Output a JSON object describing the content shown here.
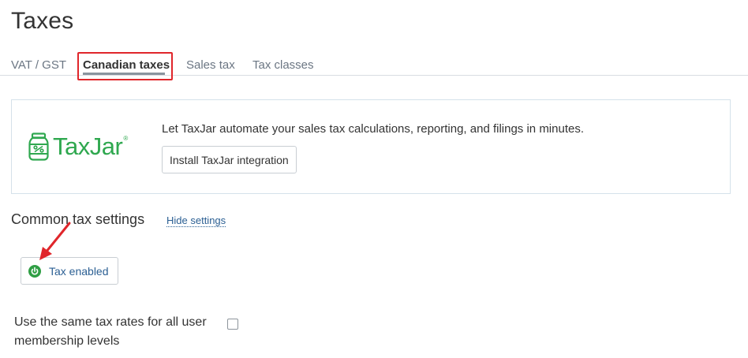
{
  "page": {
    "title": "Taxes"
  },
  "tabs": [
    {
      "label": "VAT / GST",
      "active": false
    },
    {
      "label": "Canadian taxes",
      "active": true
    },
    {
      "label": "Sales tax",
      "active": false
    },
    {
      "label": "Tax classes",
      "active": false
    }
  ],
  "promo": {
    "logo_text": "TaxJar",
    "logo_mark": "®",
    "description": "Let TaxJar automate your sales tax calculations, reporting, and filings in minutes.",
    "install_button": "Install TaxJar integration"
  },
  "settings": {
    "title": "Common tax settings",
    "hide_link": "Hide settings",
    "tax_toggle": {
      "label": "Tax enabled",
      "icon": "power-icon",
      "state": "on"
    },
    "same_rates": {
      "label": "Use the same tax rates for all user membership levels",
      "checked": false
    }
  },
  "colors": {
    "brand_green": "#2fa84f",
    "link_blue": "#2b5f93",
    "highlight_red": "#e0262b",
    "enabled_green": "#2f9e44"
  }
}
